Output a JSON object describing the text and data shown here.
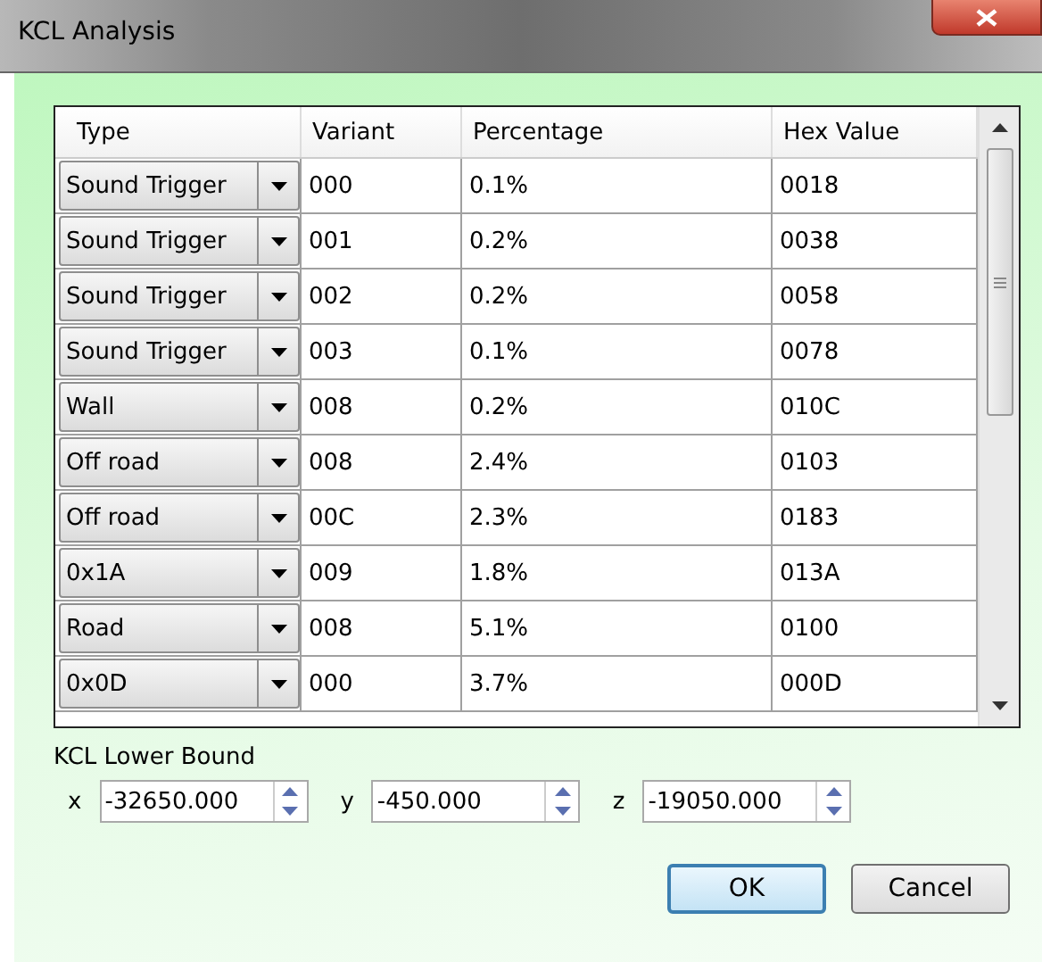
{
  "window": {
    "title": "KCL Analysis"
  },
  "table": {
    "columns": [
      "Type",
      "Variant",
      "Percentage",
      "Hex Value"
    ],
    "rows": [
      {
        "type": "Sound Trigger",
        "variant": "000",
        "percentage": "0.1%",
        "hex": "0018"
      },
      {
        "type": "Sound Trigger",
        "variant": "001",
        "percentage": "0.2%",
        "hex": "0038"
      },
      {
        "type": "Sound Trigger",
        "variant": "002",
        "percentage": "0.2%",
        "hex": "0058"
      },
      {
        "type": "Sound Trigger",
        "variant": "003",
        "percentage": "0.1%",
        "hex": "0078"
      },
      {
        "type": "Wall",
        "variant": "008",
        "percentage": "0.2%",
        "hex": "010C"
      },
      {
        "type": "Off road",
        "variant": "008",
        "percentage": "2.4%",
        "hex": "0103"
      },
      {
        "type": "Off road",
        "variant": "00C",
        "percentage": "2.3%",
        "hex": "0183"
      },
      {
        "type": "0x1A",
        "variant": "009",
        "percentage": "1.8%",
        "hex": "013A"
      },
      {
        "type": "Road",
        "variant": "008",
        "percentage": "5.1%",
        "hex": "0100"
      },
      {
        "type": "0x0D",
        "variant": "000",
        "percentage": "3.7%",
        "hex": "000D"
      }
    ]
  },
  "lower_bound": {
    "label": "KCL Lower Bound",
    "fields": [
      {
        "label": "x",
        "value": "-32650.000"
      },
      {
        "label": "y",
        "value": "-450.000"
      },
      {
        "label": "z",
        "value": "-19050.000"
      }
    ]
  },
  "buttons": [
    {
      "label": "OK",
      "default": true
    },
    {
      "label": "Cancel",
      "default": false
    }
  ]
}
